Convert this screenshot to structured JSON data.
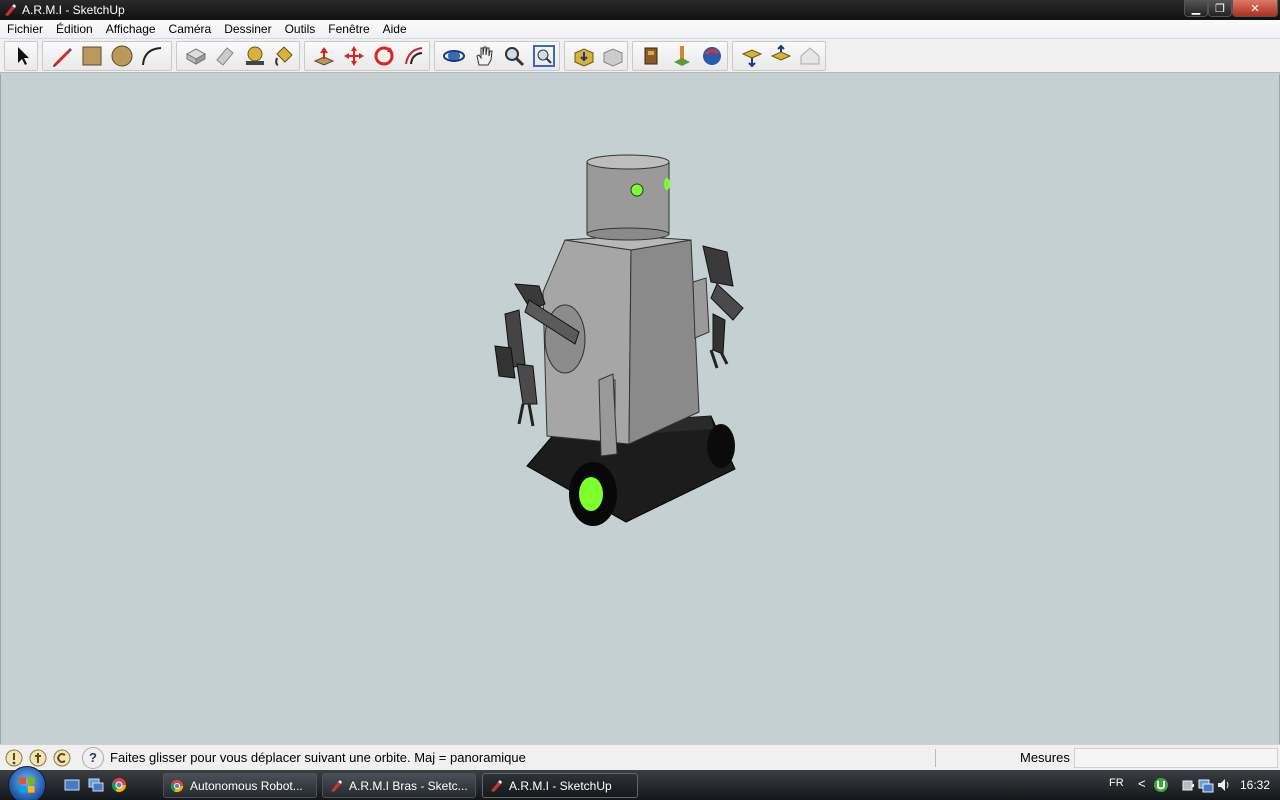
{
  "window": {
    "title": "A.R.M.I - SketchUp",
    "controls": {
      "minimize": "▁",
      "maximize": "❐",
      "close": "✕"
    }
  },
  "menu": [
    "Fichier",
    "Édition",
    "Affichage",
    "Caméra",
    "Dessiner",
    "Outils",
    "Fenêtre",
    "Aide"
  ],
  "toolbar": {
    "groups": [
      [
        "select-arrow-icon"
      ],
      [
        "pencil-line-icon",
        "rectangle-icon",
        "circle-icon",
        "arc-icon"
      ],
      [
        "make-component-icon",
        "eraser-icon",
        "tape-measure-icon",
        "paint-bucket-icon"
      ],
      [
        "push-pull-icon",
        "move-icon",
        "rotate-icon",
        "offset-icon"
      ],
      [
        "orbit-icon",
        "pan-hand-icon",
        "zoom-icon",
        "zoom-extents-icon"
      ],
      [
        "get-models-icon",
        "share-model-icon",
        "components-icon",
        "place-model-icon",
        "google-earth-icon"
      ],
      [
        "get-current-view-icon",
        "toggle-terrain-icon",
        "house-icon"
      ]
    ]
  },
  "status": {
    "message": "Faites glisser pour vous déplacer suivant une orbite.  Maj = panoramique",
    "help_glyph": "?",
    "measure_label": "Mesures",
    "measure_value": ""
  },
  "taskbar": {
    "tasks": [
      {
        "label": "Autonomous Robot...",
        "icon": "chrome-icon",
        "active": false
      },
      {
        "label": "A.R.M.I Bras - Sketc...",
        "icon": "sketchup-icon",
        "active": false
      },
      {
        "label": "A.R.M.I - SketchUp",
        "icon": "sketchup-icon",
        "active": true
      }
    ],
    "tray": {
      "language": "FR",
      "arrow": "<",
      "time": "16:32"
    }
  },
  "colors": {
    "viewport_bg": "#c5d0d2",
    "robot_body": "#8f8f8f",
    "robot_base": "#1a1a1a",
    "accent_green": "#7cff2a"
  }
}
